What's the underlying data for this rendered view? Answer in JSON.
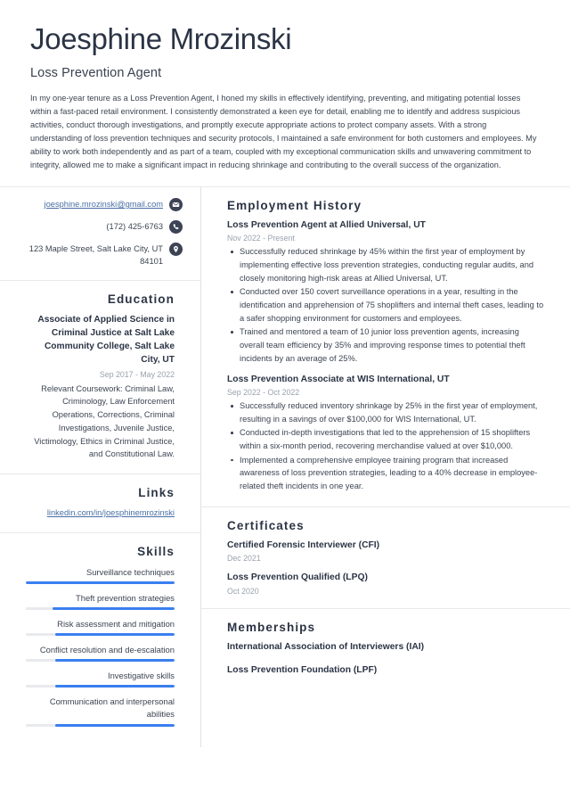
{
  "theme": {
    "text_dark": "#2b3445",
    "text_body": "#3c4452",
    "muted": "#9aa1ad",
    "link": "#4a6fa5",
    "accent_bar": "#3b7ff0",
    "bar_track": "#e9eaee",
    "icon_bg": "#3b4354",
    "divider": "#e6e8ec",
    "page_bg": "#ffffff"
  },
  "header": {
    "full_name": "Joesphine Mrozinski",
    "job_title": "Loss Prevention Agent",
    "summary": "In my one-year tenure as a Loss Prevention Agent, I honed my skills in effectively identifying, preventing, and mitigating potential losses within a fast-paced retail environment. I consistently demonstrated a keen eye for detail, enabling me to identify and address suspicious activities, conduct thorough investigations, and promptly execute appropriate actions to protect company assets. With a strong understanding of loss prevention techniques and security protocols, I maintained a safe environment for both customers and employees. My ability to work both independently and as part of a team, coupled with my exceptional communication skills and unwavering commitment to integrity, allowed me to make a significant impact in reducing shrinkage and contributing to the overall success of the organization."
  },
  "contact": {
    "email": "joesphine.mrozinski@gmail.com",
    "email_icon": "envelope-icon",
    "phone": "(172) 425-6763",
    "phone_icon": "phone-icon",
    "address": "123 Maple Street, Salt Lake City, UT 84101",
    "address_icon": "location-pin-icon"
  },
  "education": {
    "title": "Education",
    "entries": [
      {
        "degree": "Associate of Applied Science in Criminal Justice at Salt Lake Community College, Salt Lake City, UT",
        "date": "Sep 2017 - May 2022",
        "description": "Relevant Coursework: Criminal Law, Criminology, Law Enforcement Operations, Corrections, Criminal Investigations, Juvenile Justice, Victimology, Ethics in Criminal Justice, and Constitutional Law."
      }
    ]
  },
  "links": {
    "title": "Links",
    "items": [
      {
        "label": "linkedin.com/in/joesphinemrozinski"
      }
    ]
  },
  "skills": {
    "title": "Skills",
    "items": [
      {
        "name": "Surveillance techniques",
        "level": 100
      },
      {
        "name": "Theft prevention strategies",
        "level": 82
      },
      {
        "name": "Risk assessment and mitigation",
        "level": 80
      },
      {
        "name": "Conflict resolution and de-escalation",
        "level": 80
      },
      {
        "name": "Investigative skills",
        "level": 80
      },
      {
        "name": "Communication and interpersonal abilities",
        "level": 80
      }
    ]
  },
  "employment": {
    "title": "Employment History",
    "jobs": [
      {
        "heading": "Loss Prevention Agent at Allied Universal, UT",
        "date": "Nov 2022 - Present",
        "bullets": [
          "Successfully reduced shrinkage by 45% within the first year of employment by implementing effective loss prevention strategies, conducting regular audits, and closely monitoring high-risk areas at Allied Universal, UT.",
          "Conducted over 150 covert surveillance operations in a year, resulting in the identification and apprehension of 75 shoplifters and internal theft cases, leading to a safer shopping environment for customers and employees.",
          "Trained and mentored a team of 10 junior loss prevention agents, increasing overall team efficiency by 35% and improving response times to potential theft incidents by an average of 25%."
        ]
      },
      {
        "heading": "Loss Prevention Associate at WIS International, UT",
        "date": "Sep 2022 - Oct 2022",
        "bullets": [
          "Successfully reduced inventory shrinkage by 25% in the first year of employment, resulting in a savings of over $100,000 for WIS International, UT.",
          "Conducted in-depth investigations that led to the apprehension of 15 shoplifters within a six-month period, recovering merchandise valued at over $10,000.",
          "Implemented a comprehensive employee training program that increased awareness of loss prevention strategies, leading to a 40% decrease in employee-related theft incidents in one year."
        ]
      }
    ]
  },
  "certificates": {
    "title": "Certificates",
    "items": [
      {
        "name": "Certified Forensic Interviewer (CFI)",
        "date": "Dec 2021"
      },
      {
        "name": "Loss Prevention Qualified (LPQ)",
        "date": "Oct 2020"
      }
    ]
  },
  "memberships": {
    "title": "Memberships",
    "items": [
      {
        "name": "International Association of Interviewers (IAI)"
      },
      {
        "name": "Loss Prevention Foundation (LPF)"
      }
    ]
  }
}
